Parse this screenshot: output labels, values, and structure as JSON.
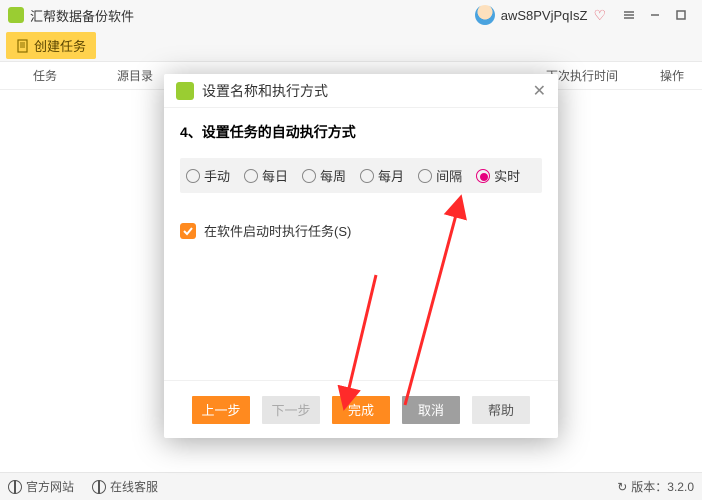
{
  "titlebar": {
    "app_name": "汇帮数据备份软件",
    "username": "awS8PVjPqIsZ"
  },
  "toolbar": {
    "create_task": "创建任务"
  },
  "columns": {
    "task": "任务",
    "source": "源目录",
    "next_run": "下次执行时间",
    "action": "操作"
  },
  "dialog": {
    "title": "设置名称和执行方式",
    "heading": "4、设置任务的自动执行方式",
    "radios": {
      "manual": "手动",
      "daily": "每日",
      "weekly": "每周",
      "monthly": "每月",
      "interval": "间隔",
      "realtime": "实时"
    },
    "checkbox_label": "在软件启动时执行任务(S)",
    "buttons": {
      "prev": "上一步",
      "next": "下一步",
      "finish": "完成",
      "cancel": "取消",
      "help": "帮助"
    }
  },
  "statusbar": {
    "site": "官方网站",
    "service": "在线客服",
    "version_label": "版本：",
    "version": "3.2.0"
  }
}
